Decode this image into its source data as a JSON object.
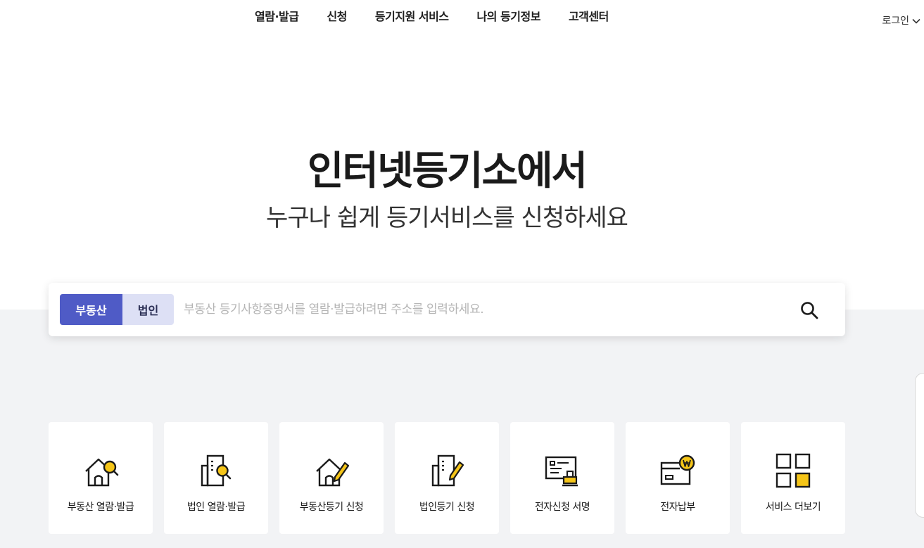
{
  "nav": {
    "items": [
      "열람·발급",
      "신청",
      "등기지원 서비스",
      "나의 등기정보",
      "고객센터"
    ],
    "login": "로그인"
  },
  "hero": {
    "title": "인터넷등기소에서",
    "subtitle": "누구나 쉽게 등기서비스를 신청하세요"
  },
  "search": {
    "tabs": [
      "부동산",
      "법인"
    ],
    "active_tab": "부동산",
    "placeholder": "부동산 등기사항증명서를 열람·발급하려면 주소를 입력하세요.",
    "value": ""
  },
  "cards": [
    {
      "label": "부동산 열람·발급",
      "icon": "house-search-icon"
    },
    {
      "label": "법인 열람·발급",
      "icon": "building-search-icon"
    },
    {
      "label": "부동산등기 신청",
      "icon": "house-pencil-icon"
    },
    {
      "label": "법인등기 신청",
      "icon": "building-pencil-icon"
    },
    {
      "label": "전자신청 서명",
      "icon": "certificate-stamp-icon"
    },
    {
      "label": "전자납부",
      "icon": "won-payment-icon"
    },
    {
      "label": "서비스 더보기",
      "icon": "grid-more-icon"
    }
  ],
  "colors": {
    "accent": "#4f5bc6",
    "tab_inactive": "#dde0f5",
    "icon_highlight": "#f5c518",
    "background_gray": "#f2f3f5"
  }
}
